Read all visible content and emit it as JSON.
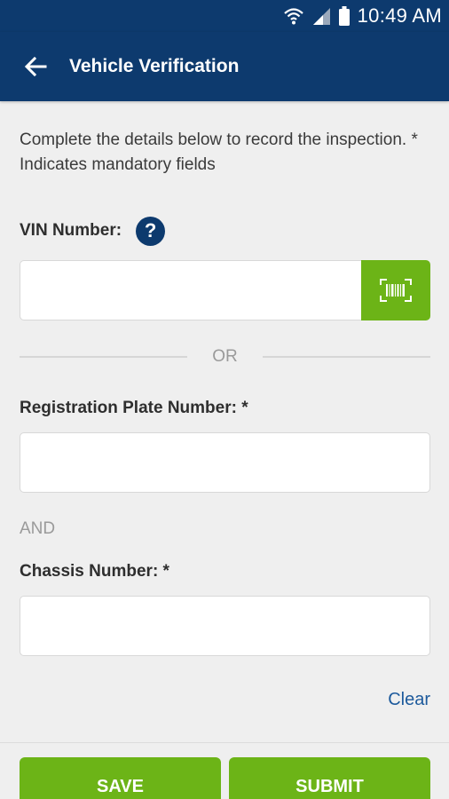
{
  "status_bar": {
    "time": "10:49 AM",
    "icons": [
      "wifi-icon",
      "signal-icon",
      "battery-icon"
    ]
  },
  "app_bar": {
    "title": "Vehicle Verification",
    "back_icon": "arrow-left-icon"
  },
  "form": {
    "intro": "Complete the details below to record the inspection. * Indicates mandatory fields",
    "vin": {
      "label": "VIN Number:",
      "help_icon": "?",
      "value": "",
      "scan_icon": "barcode-scan-icon"
    },
    "or_text": "OR",
    "registration": {
      "label": "Registration Plate Number: *",
      "value": ""
    },
    "and_text": "AND",
    "chassis": {
      "label": "Chassis Number: *",
      "value": ""
    },
    "clear_label": "Clear"
  },
  "actions": {
    "save_label": "SAVE",
    "submit_label": "SUBMIT"
  },
  "colors": {
    "primary": "#0d3a6e",
    "accent": "#6cb417",
    "link": "#1d5a9c",
    "background": "#efefef"
  }
}
